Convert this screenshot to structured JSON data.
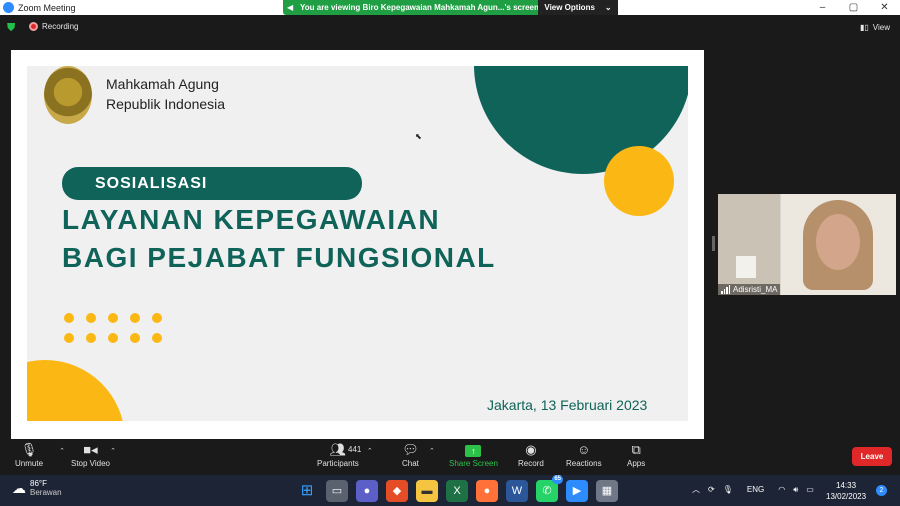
{
  "window": {
    "title": "Zoom Meeting",
    "controls": [
      "–",
      "▢",
      "✕"
    ]
  },
  "share_banner": {
    "text": "You are viewing Biro Kepegawaian Mahkamah Agun...'s screen",
    "view_options": "View Options"
  },
  "status": {
    "recording": "Recording",
    "view": "View"
  },
  "slide": {
    "org_line1": "Mahkamah Agung",
    "org_line2": "Republik Indonesia",
    "pill": "SOSIALISASI",
    "heading1": "LAYANAN KEPEGAWAIAN",
    "heading2": "BAGI PEJABAT FUNGSIONAL",
    "place_date": "Jakarta, 13 Februari 2023",
    "colors": {
      "teal": "#0f6359",
      "yellow": "#fbb713"
    }
  },
  "participant_video": {
    "name": "Adisristi_MA"
  },
  "toolbar": {
    "unmute": "Unmute",
    "stop_video": "Stop Video",
    "participants": "Participants",
    "participants_count": "441",
    "chat": "Chat",
    "share_screen": "Share Screen",
    "record": "Record",
    "reactions": "Reactions",
    "apps": "Apps",
    "leave": "Leave",
    "colors": {
      "share": "#2cc24a",
      "leave": "#e02828"
    }
  },
  "taskbar": {
    "weather_temp": "86°F",
    "weather_desc": "Berawan",
    "language": "ENG",
    "time": "14:33",
    "date": "13/02/2023",
    "notifications": "2",
    "whatsapp_badge": "65"
  }
}
